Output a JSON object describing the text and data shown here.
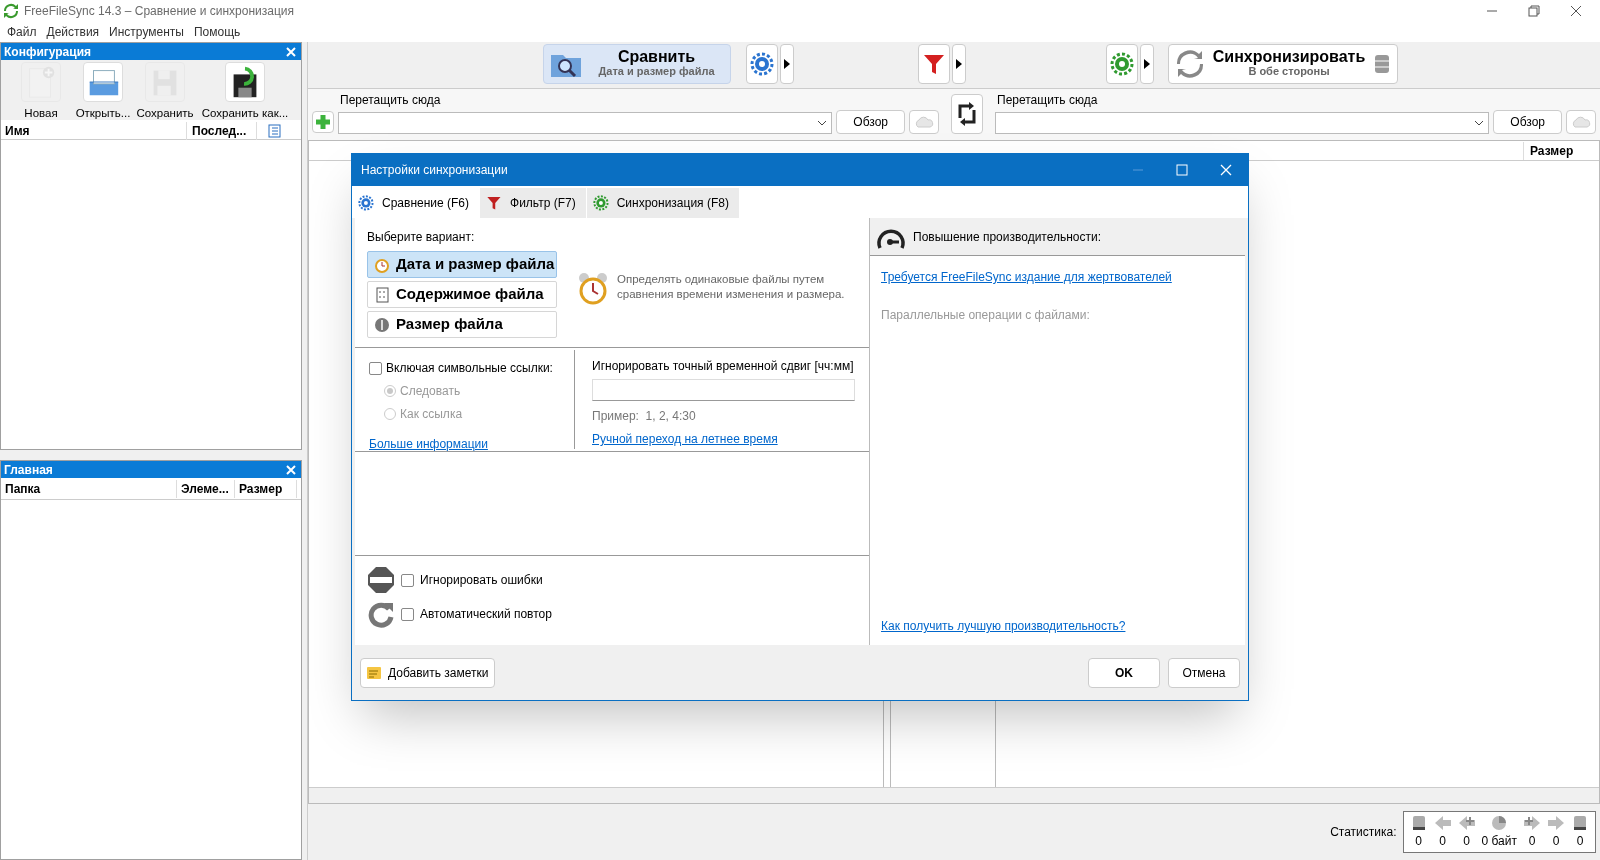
{
  "window": {
    "title": "FreeFileSync 14.3 – Сравнение и синхронизация"
  },
  "menu": [
    "Файл",
    "Действия",
    "Инструменты",
    "Помощь"
  ],
  "config_panel": {
    "title": "Конфигурация",
    "tools": [
      {
        "label": "Новая",
        "kind": "new",
        "disabled": true
      },
      {
        "label": "Открыть...",
        "kind": "open",
        "disabled": false
      },
      {
        "label": "Сохранить",
        "kind": "save",
        "disabled": true
      },
      {
        "label": "Сохранить как...",
        "kind": "saveas",
        "disabled": false
      }
    ],
    "columns": [
      "Имя",
      "Послед..."
    ]
  },
  "main_panel": {
    "title": "Главная",
    "columns": [
      "Папка",
      "Элеме...",
      "Размер"
    ]
  },
  "toolbar": {
    "compare": {
      "label": "Сравнить",
      "variant": "Дата и размер файла"
    },
    "sync": {
      "label": "Синхронизировать",
      "variant": "В обе стороны"
    }
  },
  "folders": [
    {
      "label": "Перетащить сюда",
      "browse": "Обзор"
    },
    {
      "label": "Перетащить сюда",
      "browse": "Обзор"
    }
  ],
  "grid": {
    "right_column": "Размер"
  },
  "statistics": {
    "label": "Статистика:",
    "counts": [
      "0",
      "0",
      "0",
      "0 байт",
      "0",
      "0",
      "0"
    ]
  },
  "dialog": {
    "title": "Настройки синхронизации",
    "tabs": [
      {
        "label": "Сравнение (F6)",
        "kind": "gear",
        "selected": true
      },
      {
        "label": "Фильтр (F7)",
        "kind": "filter",
        "selected": false
      },
      {
        "label": "Синхронизация (F8)",
        "kind": "gear",
        "selected": false
      }
    ],
    "prompt": "Выберите вариант:",
    "variants": [
      {
        "label": "Дата и размер файла",
        "kind": "time",
        "selected": true
      },
      {
        "label": "Содержимое файла",
        "kind": "content",
        "selected": false
      },
      {
        "label": "Размер файла",
        "kind": "size",
        "selected": false
      }
    ],
    "description": "Определять одинаковые файлы путем сравнения времени изменения и размера.",
    "symlinks": {
      "label": "Включая символьные ссылки:",
      "checked": false,
      "options": [
        {
          "label": "Следовать",
          "selected": true
        },
        {
          "label": "Как ссылка",
          "selected": false
        }
      ]
    },
    "more_info": "Больше информации",
    "time_shift": {
      "label": "Игнорировать точный временной сдвиг [чч:мм]",
      "example": "Пример:  1, 2, 4:30",
      "link": "Ручной переход на летнее время"
    },
    "ignore_errors": {
      "label": "Игнорировать ошибки",
      "checked": false
    },
    "auto_retry": {
      "label": "Автоматический повтор",
      "checked": false
    },
    "notes_button": "Добавить заметки",
    "performance": {
      "title": "Повышение производительности:",
      "donor_link": "Требуется FreeFileSync издание для жертвователей",
      "parallel": "Параллельные операции с файлами:",
      "help_link": "Как получить лучшую производительность?"
    },
    "buttons": [
      "OK",
      "Отмена"
    ]
  }
}
